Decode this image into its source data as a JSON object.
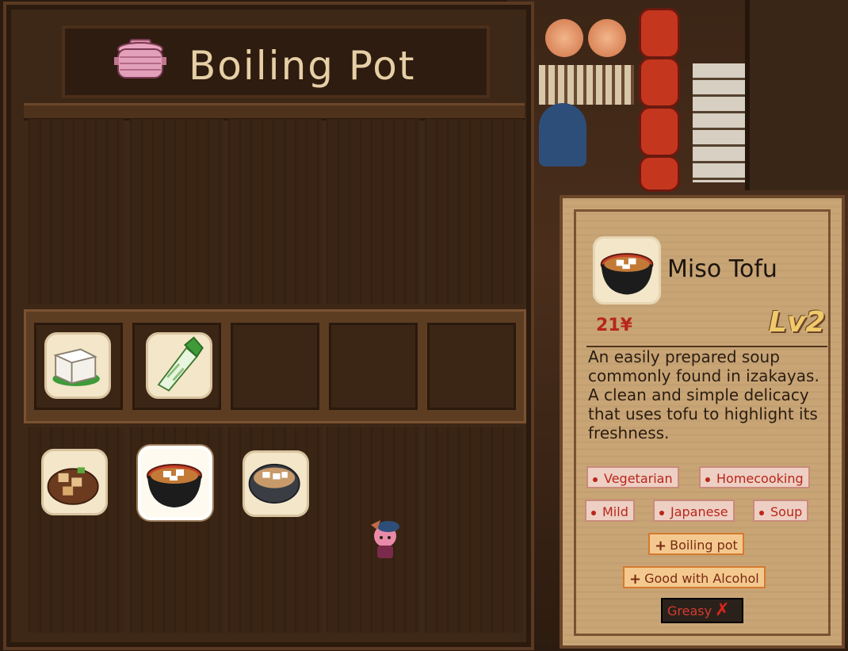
{
  "panel": {
    "title": "Boiling Pot",
    "pot_icon": "pot-icon"
  },
  "ingredients": [
    {
      "name": "tofu",
      "icon": "tofu-icon"
    },
    {
      "name": "green-onion",
      "icon": "green-onion-icon"
    },
    {
      "name": "",
      "icon": ""
    },
    {
      "name": "",
      "icon": ""
    },
    {
      "name": "",
      "icon": ""
    }
  ],
  "dishes": [
    {
      "icon": "fried-tofu-dish-icon",
      "selected": false
    },
    {
      "icon": "miso-tofu-bowl-icon",
      "selected": true
    },
    {
      "icon": "tofu-pot-icon",
      "selected": false
    }
  ],
  "detail": {
    "name": "Miso Tofu",
    "price": "21¥",
    "level": "Lv2",
    "description": "An easily prepared soup commonly found in izakayas. A clean and simple delicacy that uses tofu to highlight its freshness.",
    "tags": [
      "Vegetarian",
      "Homecooking",
      "Mild",
      "Japanese",
      "Soup"
    ],
    "bonus_tags": [
      "Boiling pot",
      "Good with Alcohol"
    ],
    "negative_tag": "Greasy"
  },
  "colors": {
    "panel_bg": "#3d2716",
    "card_bg": "#c9a576",
    "tag_red": "#b8261b",
    "title_text": "#e6cfa5"
  }
}
